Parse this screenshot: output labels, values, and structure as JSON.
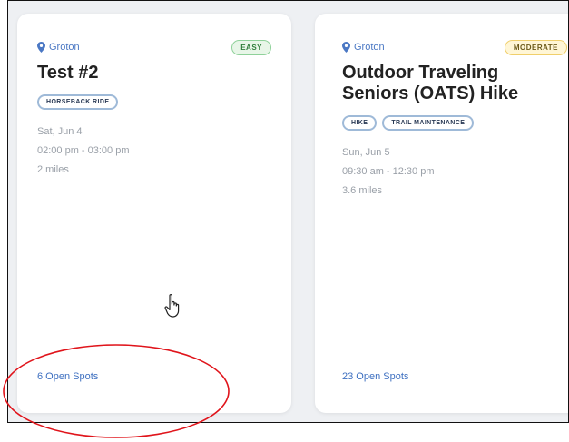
{
  "colors": {
    "accent_link": "#3d6fc0",
    "annotation_ring": "#e0141b",
    "easy_badge": "#8fd19a",
    "moderate_badge": "#f0cf6b"
  },
  "icons": {
    "location": "map-pin-icon",
    "pointer": "hand-cursor-icon"
  },
  "events": [
    {
      "location": "Groton",
      "difficulty": "EASY",
      "title": "Test #2",
      "tags": [
        "HORSEBACK RIDE"
      ],
      "date": "Sat, Jun 4",
      "time": "02:00 pm - 03:00 pm",
      "distance": "2 miles",
      "open_spots": "6 Open Spots"
    },
    {
      "location": "Groton",
      "difficulty": "MODERATE",
      "title": "Outdoor Traveling Seniors (OATS) Hike",
      "tags": [
        "HIKE",
        "TRAIL MAINTENANCE"
      ],
      "date": "Sun, Jun 5",
      "time": "09:30 am - 12:30 pm",
      "distance": "3.6 miles",
      "open_spots": "23 Open Spots"
    }
  ]
}
